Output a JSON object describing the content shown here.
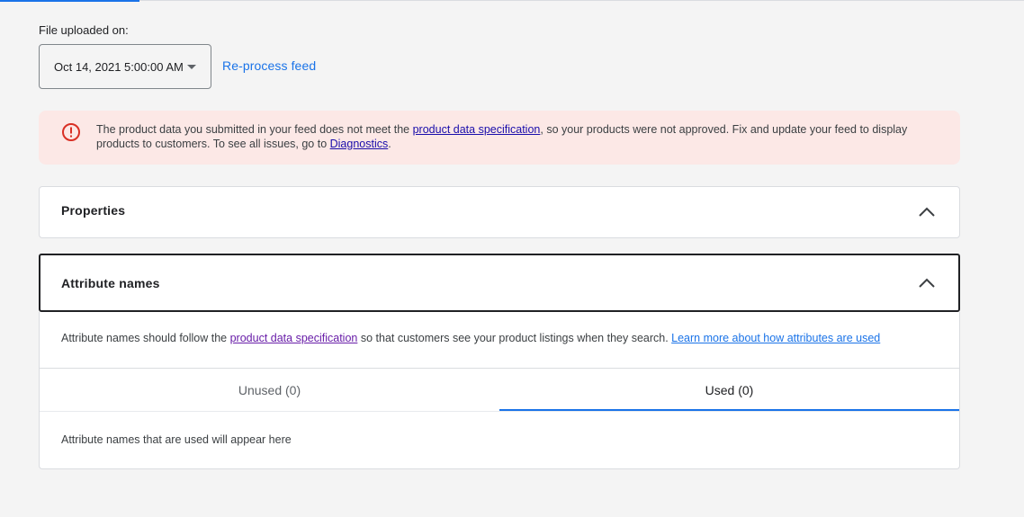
{
  "upload": {
    "label": "File uploaded on:",
    "selected_date": "Oct 14, 2021 5:00:00 AM",
    "reprocess_label": "Re-process feed"
  },
  "alert": {
    "icon": "error-circle-icon",
    "text_1": "The product data you submitted in your feed does not meet the ",
    "link_1": "product data specification",
    "text_2": ", so your products were not approved. Fix and update your feed to display products to customers. To see all issues, go to ",
    "link_2": "Diagnostics",
    "text_3": ".",
    "color": "#d93025"
  },
  "panels": {
    "properties_title": "Properties",
    "attribute_title": "Attribute names"
  },
  "attributes": {
    "desc_1": "Attribute names should follow the ",
    "desc_link_1": "product data specification",
    "desc_2": " so that customers see your product listings when they search. ",
    "desc_link_2": "Learn more about how attributes are used",
    "tabs": [
      {
        "label": "Unused (0)",
        "selected": false
      },
      {
        "label": "Used (0)",
        "selected": true
      }
    ],
    "empty_message": "Attribute names that are used will appear here"
  },
  "colors": {
    "accent": "#1a73e8",
    "alert_bg": "#fce8e6",
    "background": "#f4f4f4"
  }
}
